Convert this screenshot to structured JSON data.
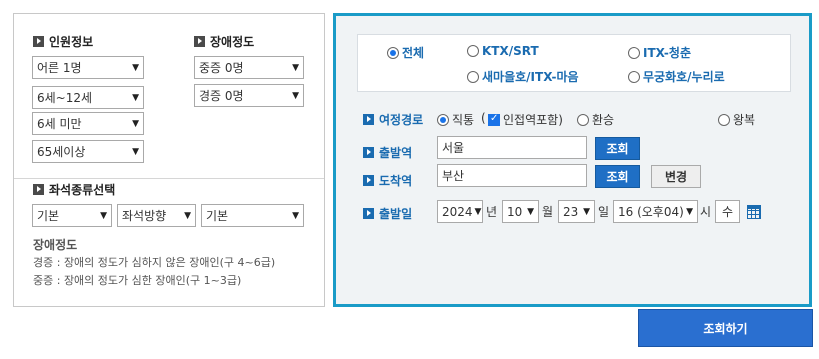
{
  "passenger": {
    "title": "인원정보",
    "adult": "어른 1명",
    "child": "6세~12세",
    "infant": "6세 미만",
    "senior": "65세이상"
  },
  "disability": {
    "title": "장애정도",
    "severe": "중증 0명",
    "mild": "경증 0명"
  },
  "seat": {
    "title": "좌석종류선택",
    "type": "기본",
    "direction": "좌석방향",
    "extra": "기본"
  },
  "help": {
    "title": "장애정도",
    "mild_desc": "경증 : 장애의 정도가 심하지 않은 장애인(구 4~6급)",
    "severe_desc": "중증 : 장애의 정도가 심한 장애인(구 1~3급)"
  },
  "train_types": {
    "all": "전체",
    "ktx": "KTX/SRT",
    "itx": "ITX-청춘",
    "saemaeul": "새마을호/ITX-마음",
    "mugunghwa": "무궁화호/누리로"
  },
  "route": {
    "label": "여정경로",
    "direct": "직통",
    "nearby_prefix": "(",
    "nearby": "인접역포함)",
    "transfer": "환승",
    "round_trip": "왕복"
  },
  "departure": {
    "label": "출발역",
    "value": "서울",
    "button": "조회"
  },
  "arrival": {
    "label": "도착역",
    "value": "부산",
    "button": "조회",
    "swap_button": "변경"
  },
  "date": {
    "label": "출발일",
    "year": "2024",
    "year_unit": "년",
    "month": "10",
    "month_unit": "월",
    "day": "23",
    "day_unit": "일",
    "hour": "16 (오후04)",
    "hour_unit": "시",
    "weekday": "수"
  },
  "search_button": "조회하기",
  "colors": {
    "accent": "#1a9bc7",
    "button_blue": "#1f6fc5"
  }
}
